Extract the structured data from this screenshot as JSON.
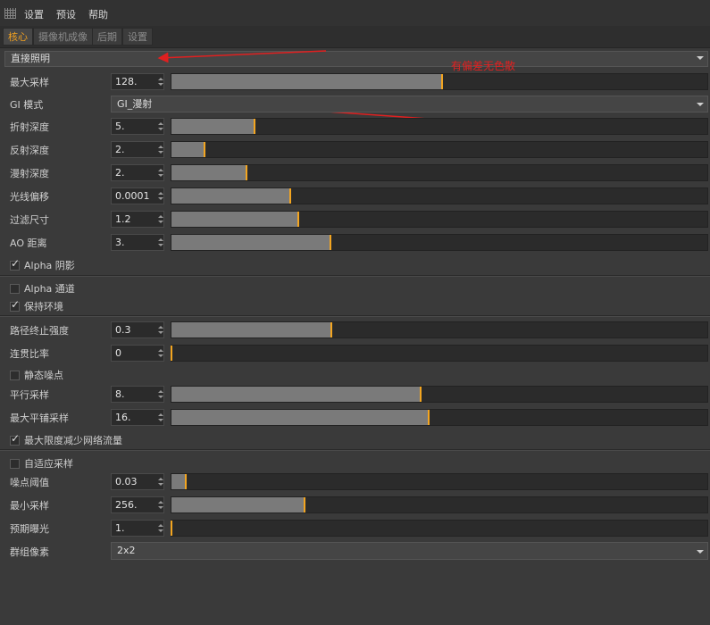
{
  "menubar": {
    "items": [
      "设置",
      "预设",
      "帮助"
    ]
  },
  "tabs": [
    {
      "label": "核心",
      "active": true
    },
    {
      "label": "摄像机成像",
      "active": false
    },
    {
      "label": "后期",
      "active": false
    },
    {
      "label": "设置",
      "active": false
    }
  ],
  "lighting_mode": {
    "value": "直接照明"
  },
  "annotation": {
    "text": "有偏差无色散",
    "color": "#e02020"
  },
  "fields": {
    "max_samples": {
      "label": "最大采样",
      "value": "128.",
      "slider_fraction": 0.505
    },
    "gi_mode": {
      "label": "GI 模式",
      "value": "GI_漫射"
    },
    "refraction_depth": {
      "label": "折射深度",
      "value": "5.",
      "slider_fraction": 0.155
    },
    "reflection_depth": {
      "label": "反射深度",
      "value": "2.",
      "slider_fraction": 0.062
    },
    "diffuse_depth": {
      "label": "漫射深度",
      "value": "2.",
      "slider_fraction": 0.14
    },
    "ray_offset": {
      "label": "光线偏移",
      "value": "0.0001",
      "slider_fraction": 0.222
    },
    "filter_size": {
      "label": "过滤尺寸",
      "value": "1.2",
      "slider_fraction": 0.237
    },
    "ao_distance": {
      "label": "AO 距离",
      "value": "3.",
      "slider_fraction": 0.297
    },
    "alpha_shadow": {
      "label": "Alpha 阴影",
      "checked": true
    },
    "alpha_channel": {
      "label": "Alpha 通道",
      "checked": false
    },
    "keep_environment": {
      "label": "保持环境",
      "checked": true
    },
    "path_termination": {
      "label": "路径终止强度",
      "value": "0.3",
      "slider_fraction": 0.299
    },
    "coherent_ratio": {
      "label": "连贯比率",
      "value": "0",
      "slider_fraction": 0.0
    },
    "static_noise": {
      "label": "静态噪点",
      "checked": false
    },
    "parallel_samples": {
      "label": "平行采样",
      "value": "8.",
      "slider_fraction": 0.465
    },
    "max_tile_samples": {
      "label": "最大平铺采样",
      "value": "16.",
      "slider_fraction": 0.48
    },
    "minimize_network": {
      "label": "最大限度减少网络流量",
      "checked": true
    },
    "adaptive_sampling": {
      "label": "自适应采样",
      "checked": false
    },
    "noise_threshold": {
      "label": "噪点阈值",
      "value": "0.03",
      "slider_fraction": 0.027
    },
    "min_samples": {
      "label": "最小采样",
      "value": "256.",
      "slider_fraction": 0.248
    },
    "expected_exposure": {
      "label": "预期曝光",
      "value": "1.",
      "slider_fraction": 0.0
    },
    "group_pixels": {
      "label": "群组像素",
      "value": "2x2"
    }
  }
}
